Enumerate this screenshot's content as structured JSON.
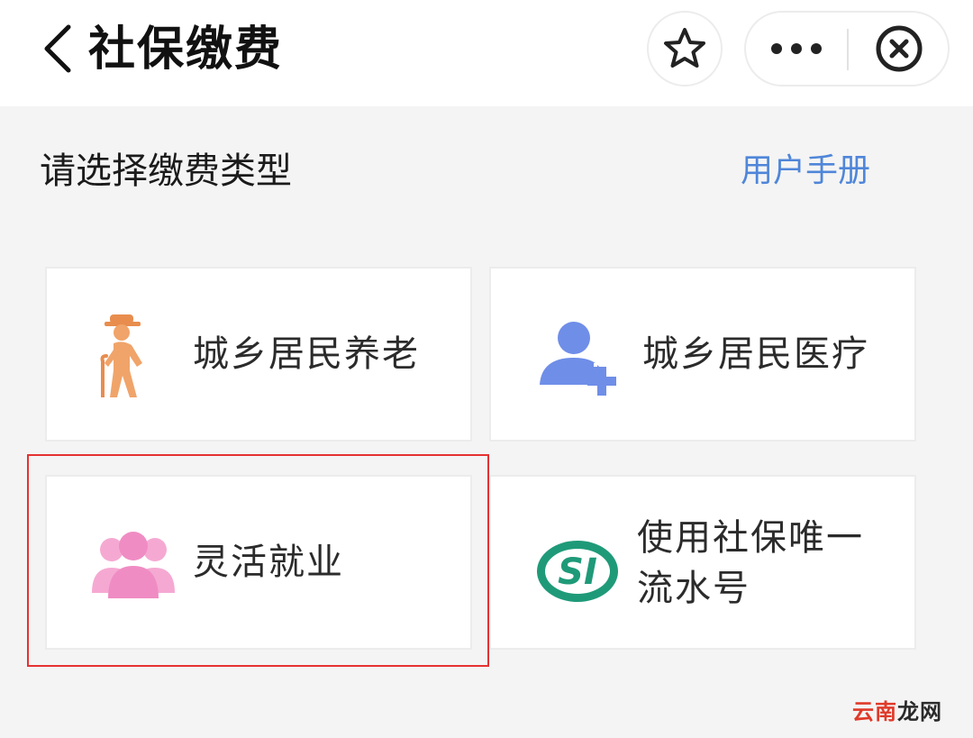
{
  "header": {
    "title": "社保缴费",
    "back_icon": "chevron-left-icon",
    "favorite_icon": "star-icon",
    "more_icon": "more-dots-icon",
    "close_icon": "close-circle-icon"
  },
  "main": {
    "prompt": "请选择缴费类型",
    "manual_link": "用户手册",
    "link_color": "#4f86d9",
    "options": [
      {
        "label": "城乡居民养老",
        "icon": "elderly-person-icon",
        "icon_color": "#f0a46a"
      },
      {
        "label": "城乡居民医疗",
        "icon": "add-person-icon",
        "icon_color": "#6f8ee8"
      },
      {
        "label": "灵活就业",
        "icon": "people-group-icon",
        "icon_color": "#f08cc4",
        "highlighted": true
      },
      {
        "label_line1": "使用社保唯一",
        "label_line2": "流水号",
        "icon": "si-logo-icon",
        "icon_color": "#1f9a79"
      }
    ],
    "highlight_color": "#e53232"
  },
  "watermark": {
    "part1": "云南",
    "part2": "龙网"
  }
}
